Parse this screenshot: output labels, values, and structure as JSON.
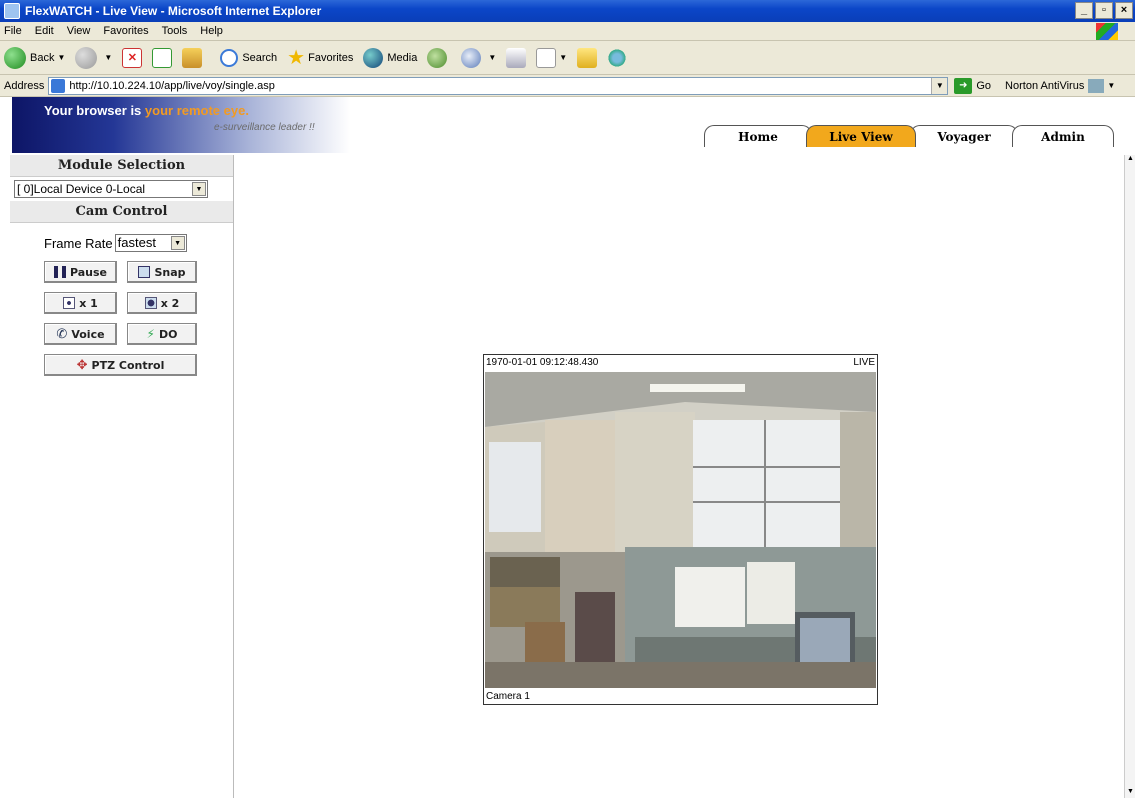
{
  "window": {
    "title": "FlexWATCH - Live View - Microsoft Internet Explorer",
    "buttons": [
      "_",
      "▫",
      "×"
    ]
  },
  "menubar": {
    "items": [
      "File",
      "Edit",
      "View",
      "Favorites",
      "Tools",
      "Help"
    ]
  },
  "toolbar": {
    "back_label": "Back",
    "search_label": "Search",
    "favorites_label": "Favorites",
    "media_label": "Media"
  },
  "addressbar": {
    "label": "Address",
    "url": "http://10.10.224.10/app/live/voy/single.asp",
    "go_label": "Go",
    "norton_label": "Norton AntiVirus"
  },
  "banner": {
    "tagline_pre": "Your browser is ",
    "tagline_hl": "your remote eye.",
    "subline": "e-surveillance leader !!"
  },
  "tabs": [
    {
      "label": "Home",
      "active": false
    },
    {
      "label": "Live View",
      "active": true
    },
    {
      "label": "Voyager",
      "active": false
    },
    {
      "label": "Admin",
      "active": false
    }
  ],
  "sidebar": {
    "module_heading": "Module Selection",
    "module_value": "[ 0]Local Device 0-Local",
    "cam_heading": "Cam Control",
    "frame_rate_label": "Frame Rate",
    "frame_rate_value": "fastest",
    "pause_label": "Pause",
    "snap_label": "Snap",
    "x1_label": "x 1",
    "x2_label": "x 2",
    "voice_label": "Voice",
    "do_label": "DO",
    "ptz_label": "PTZ Control"
  },
  "video": {
    "timestamp": "1970-01-01 09:12:48.430",
    "status": "LIVE",
    "camera_name": "Camera 1"
  },
  "colors": {
    "active_tab": "#f2a81c",
    "title_bar": "#0b46c8",
    "tagline_highlight": "#f29a22"
  }
}
